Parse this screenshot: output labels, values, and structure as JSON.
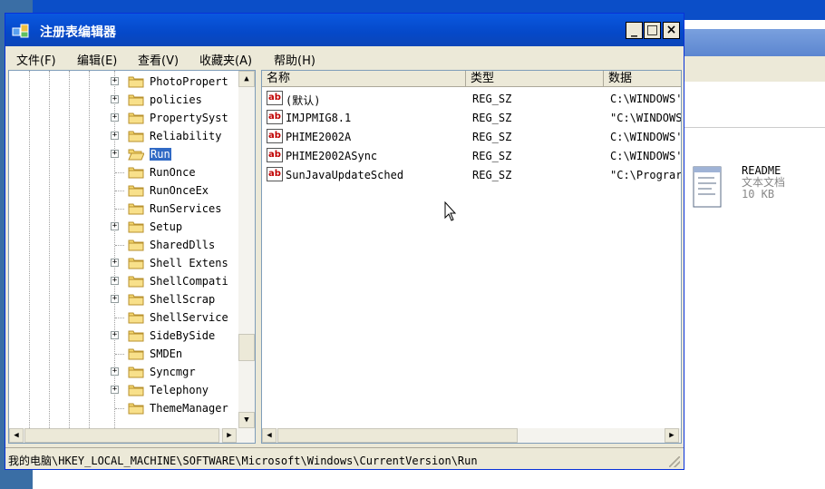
{
  "window": {
    "title": "注册表编辑器",
    "minimize": "_",
    "maximize": "□",
    "close": "×"
  },
  "menu": [
    "文件(F)",
    "编辑(E)",
    "查看(V)",
    "收藏夹(A)",
    "帮助(H)"
  ],
  "tree": {
    "items": [
      {
        "label": "PhotoPropert",
        "expandable": true,
        "selected": false
      },
      {
        "label": "policies",
        "expandable": true,
        "selected": false
      },
      {
        "label": "PropertySyst",
        "expandable": true,
        "selected": false
      },
      {
        "label": "Reliability",
        "expandable": true,
        "selected": false
      },
      {
        "label": "Run",
        "expandable": true,
        "selected": true
      },
      {
        "label": "RunOnce",
        "expandable": false,
        "selected": false
      },
      {
        "label": "RunOnceEx",
        "expandable": false,
        "selected": false
      },
      {
        "label": "RunServices",
        "expandable": false,
        "selected": false
      },
      {
        "label": "Setup",
        "expandable": true,
        "selected": false
      },
      {
        "label": "SharedDlls",
        "expandable": false,
        "selected": false
      },
      {
        "label": "Shell Extens",
        "expandable": true,
        "selected": false
      },
      {
        "label": "ShellCompati",
        "expandable": true,
        "selected": false
      },
      {
        "label": "ShellScrap",
        "expandable": true,
        "selected": false
      },
      {
        "label": "ShellService",
        "expandable": false,
        "selected": false
      },
      {
        "label": "SideBySide",
        "expandable": true,
        "selected": false
      },
      {
        "label": "SMDEn",
        "expandable": false,
        "selected": false
      },
      {
        "label": "Syncmgr",
        "expandable": true,
        "selected": false
      },
      {
        "label": "Telephony",
        "expandable": true,
        "selected": false
      },
      {
        "label": "ThemeManager",
        "expandable": false,
        "selected": false
      }
    ]
  },
  "list": {
    "columns": [
      "名称",
      "类型",
      "数据"
    ],
    "rows": [
      {
        "name": "(默认)",
        "type": "REG_SZ",
        "data": "C:\\WINDOWS'"
      },
      {
        "name": "IMJPMIG8.1",
        "type": "REG_SZ",
        "data": "\"C:\\WINDOWS"
      },
      {
        "name": "PHIME2002A",
        "type": "REG_SZ",
        "data": "C:\\WINDOWS'"
      },
      {
        "name": "PHIME2002ASync",
        "type": "REG_SZ",
        "data": "C:\\WINDOWS'"
      },
      {
        "name": "SunJavaUpdateSched",
        "type": "REG_SZ",
        "data": "\"C:\\Prograr"
      }
    ],
    "value_icon": "ab"
  },
  "status": "我的电脑\\HKEY_LOCAL_MACHINE\\SOFTWARE\\Microsoft\\Windows\\CurrentVersion\\Run",
  "background_file": {
    "name": "README",
    "type": "文本文档",
    "size": "10 KB"
  },
  "colors": {
    "titlebar": "#0548c8",
    "selection": "#316ac5",
    "window_face": "#ece9d8"
  }
}
